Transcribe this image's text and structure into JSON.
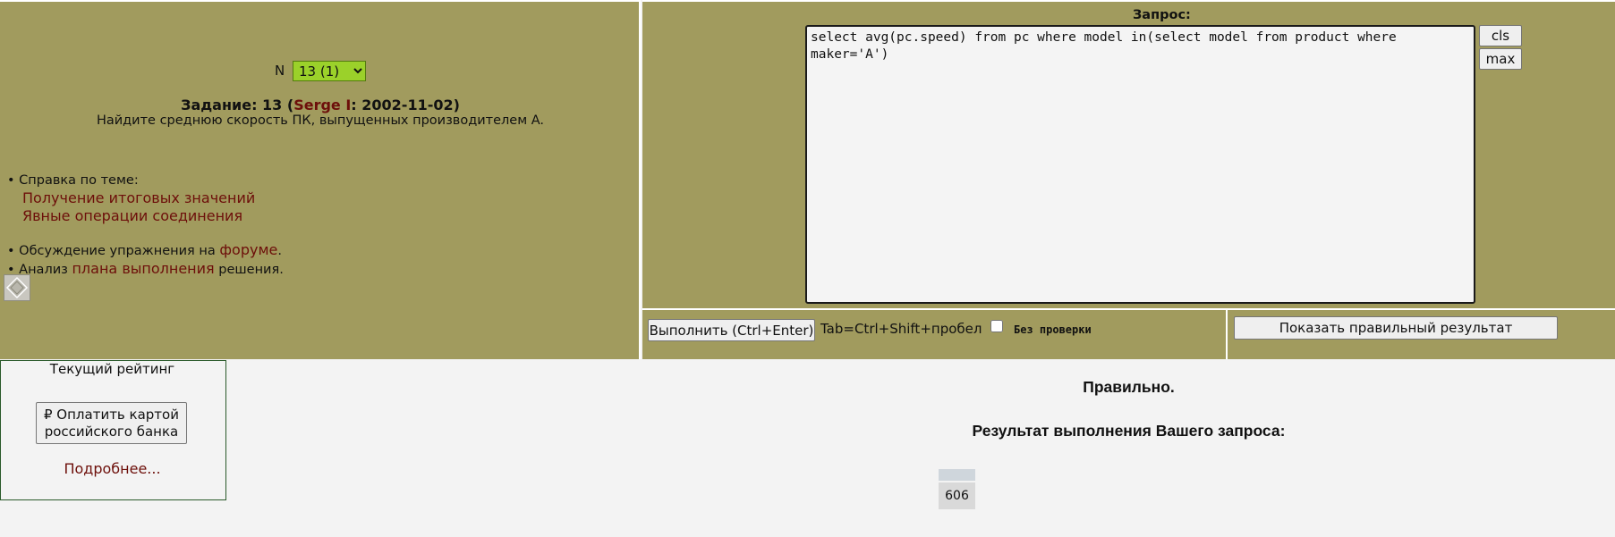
{
  "task": {
    "n_label": "N",
    "selected_option": "13 (1)",
    "title_prefix": "Задание: 13 (",
    "author": "Serge I",
    "title_suffix": ": 2002-11-02)",
    "description": "Найдите среднюю скорость ПК, выпущенных производителем A."
  },
  "help": {
    "header": "• Справка по теме:",
    "links": [
      "Получение итоговых значений",
      "Явные операции соединения"
    ],
    "forum_prefix": "• Обсуждение упражнения на ",
    "forum_link": "форуме",
    "forum_suffix": ".",
    "plan_prefix": "• Анализ ",
    "plan_link": "плана выполнения",
    "plan_suffix": " решения."
  },
  "query": {
    "label": "Запрос:",
    "text": "select avg(pc.speed) from pc where model in(select model from product where maker='A')",
    "cls_label": "cls",
    "max_label": "max"
  },
  "run_bar": {
    "run_label": "Выполнить (Ctrl+Enter)",
    "tab_hint": "Tab=Ctrl+Shift+пробел",
    "no_check_label": "Без проверки",
    "no_check_checked": false
  },
  "show_result_label": "Показать правильный результат",
  "rating": {
    "title": "Текущий рейтинг",
    "pay_label": "₽ Оплатить картой российского банка",
    "more_label": "Подробнее..."
  },
  "result": {
    "status": "Правильно.",
    "title": "Результат выполнения Вашего запроса:",
    "columns": [
      ""
    ],
    "rows": [
      [
        "606"
      ]
    ]
  },
  "colors": {
    "panel_bg": "#a19b5e",
    "select_bg": "#9bd12a",
    "link": "#6d0f0a"
  }
}
